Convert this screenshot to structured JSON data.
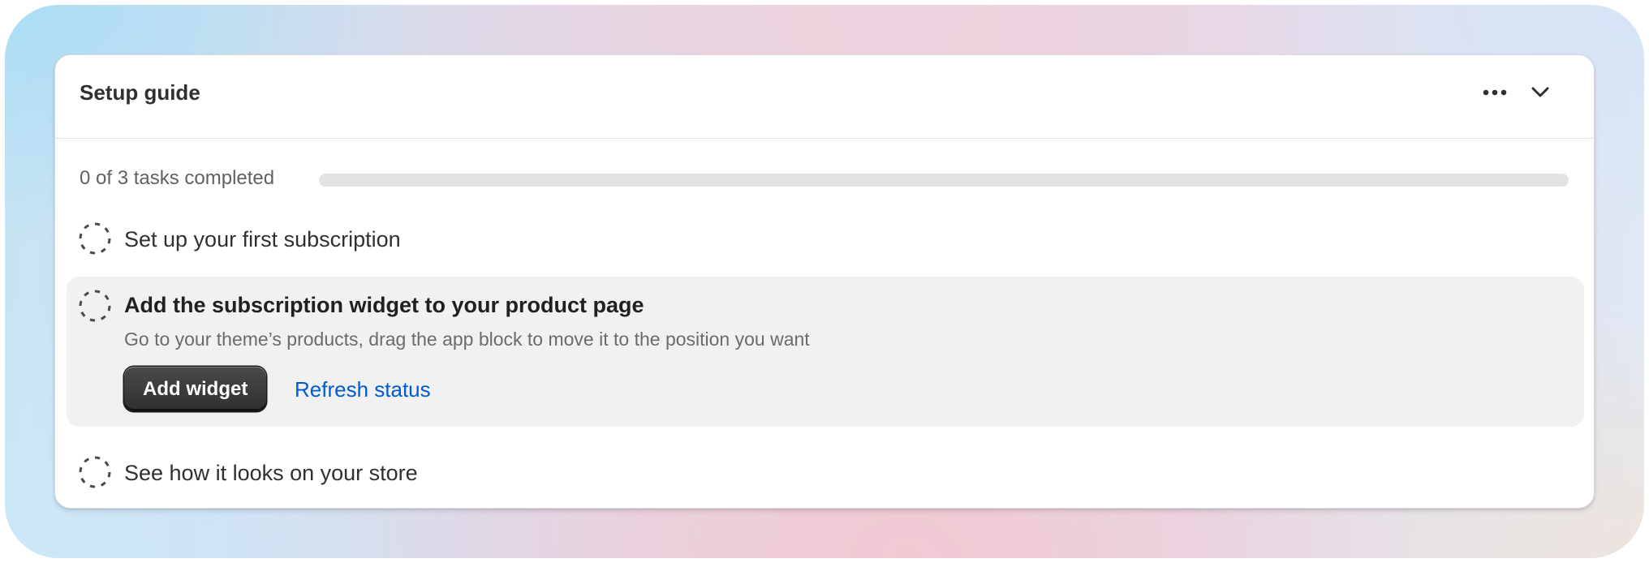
{
  "card": {
    "title": "Setup guide",
    "more_icon": "more-horizontal-icon",
    "collapse_icon": "chevron-down-icon"
  },
  "progress": {
    "label": "0 of 3 tasks completed",
    "completed": 0,
    "total": 3
  },
  "tasks": [
    {
      "title": "Set up your first subscription",
      "status_icon": "incomplete-circle-icon",
      "completed": false
    },
    {
      "title": "Add the subscription widget to your product page",
      "description": "Go to your theme’s products, drag the app block to move it to the position you want",
      "primary_action": "Add widget",
      "secondary_action": "Refresh status",
      "status_icon": "incomplete-circle-icon",
      "completed": false,
      "expanded": true
    },
    {
      "title": "See how it looks on your store",
      "status_icon": "incomplete-circle-icon",
      "completed": false
    }
  ],
  "colors": {
    "link": "#005bd3",
    "primary_button": "#303030",
    "expanded_background": "#f1f1f1",
    "progress_track": "#e3e3e3"
  }
}
